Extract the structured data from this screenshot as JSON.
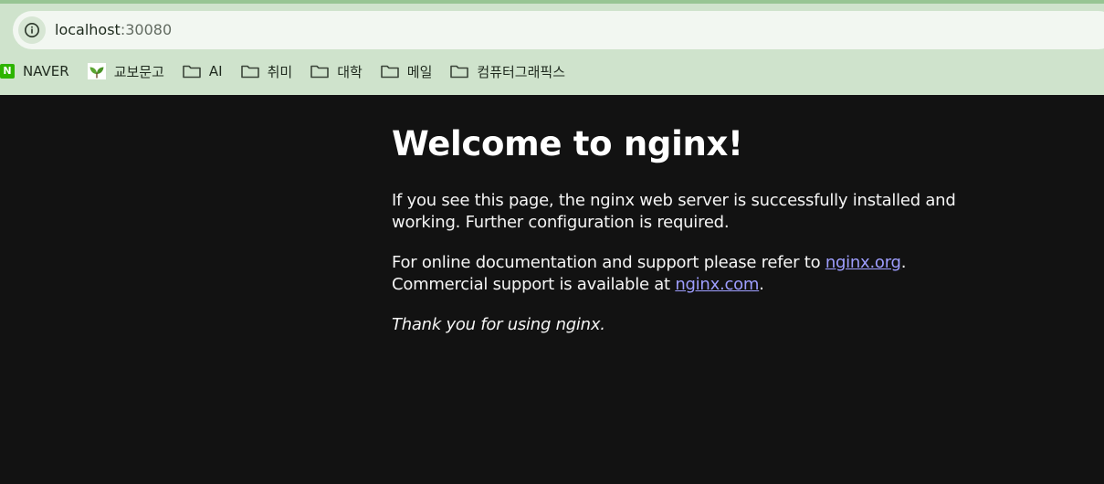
{
  "address_bar": {
    "host": "localhost",
    "port": ":30080",
    "site_info_icon": "info-circle-icon"
  },
  "bookmarks": [
    {
      "label": "NAVER",
      "icon": "naver-logo-icon"
    },
    {
      "label": "교보문고",
      "icon": "kyobo-logo-icon"
    },
    {
      "label": "AI",
      "icon": "folder-icon"
    },
    {
      "label": "취미",
      "icon": "folder-icon"
    },
    {
      "label": "대학",
      "icon": "folder-icon"
    },
    {
      "label": "메일",
      "icon": "folder-icon"
    },
    {
      "label": "컴퓨터그래픽스",
      "icon": "folder-icon"
    }
  ],
  "page": {
    "heading": "Welcome to nginx!",
    "para1": "If you see this page, the nginx web server is successfully installed and working. Further configuration is required.",
    "para2_prefix": "For online documentation and support please refer to ",
    "link_org": "nginx.org",
    "para2_mid": ".",
    "para2_line2_prefix": "Commercial support is available at ",
    "link_com": "nginx.com",
    "para2_suffix": ".",
    "thanks": "Thank you for using nginx."
  },
  "colors": {
    "chrome_background": "#cfe3cc",
    "page_background": "#121212",
    "link": "#9e9eff",
    "text": "#f5f5f5"
  }
}
